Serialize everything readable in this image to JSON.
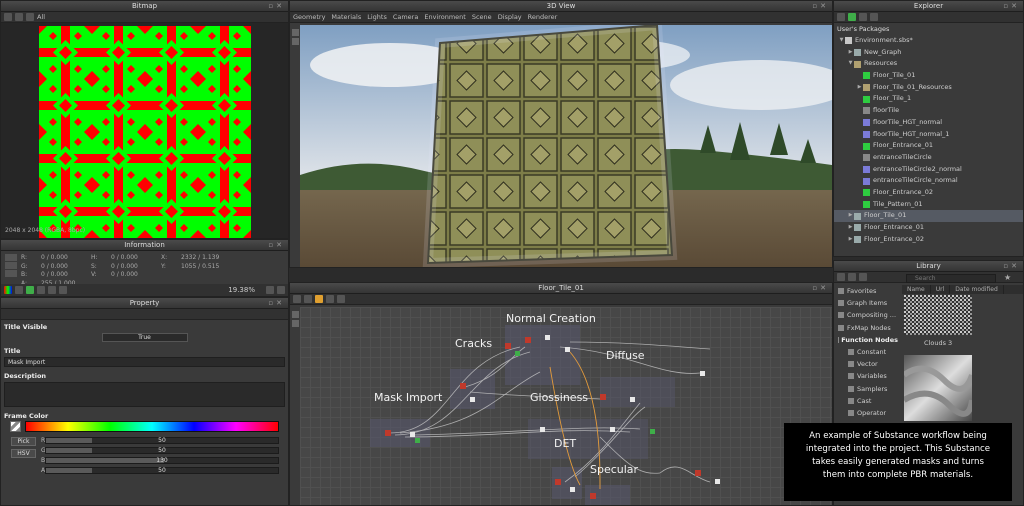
{
  "bitmap": {
    "title": "Bitmap",
    "caption": "2048 x 2048 (RGBA, 8bpc)",
    "mode_label": "All"
  },
  "information": {
    "title": "Information",
    "rows": [
      [
        "R:",
        "0 / 0.000",
        "H:",
        "0 / 0.000",
        "X:",
        "2332 / 1.139"
      ],
      [
        "G:",
        "0 / 0.000",
        "S:",
        "0 / 0.000",
        "Y:",
        "1055 / 0.515"
      ],
      [
        "B:",
        "0 / 0.000",
        "V:",
        "0 / 0.000",
        "",
        ""
      ],
      [
        "A:",
        "255 / 1.000",
        "",
        "",
        "",
        ""
      ]
    ],
    "zoom": "19.38%"
  },
  "property": {
    "title": "Property",
    "sections": {
      "title_visible": "Title Visible",
      "title_visible_value": "True",
      "title": "Title",
      "title_value": "Mask Import",
      "description": "Description",
      "frame_color": "Frame Color"
    },
    "pick": "Pick",
    "hsv": "HSV",
    "channels": [
      {
        "label": "R",
        "value": "50",
        "fraction": 0.2
      },
      {
        "label": "G",
        "value": "50",
        "fraction": 0.2
      },
      {
        "label": "B",
        "value": "130",
        "fraction": 0.51
      },
      {
        "label": "A",
        "value": "50",
        "fraction": 0.2
      }
    ]
  },
  "view3d": {
    "title": "3D View",
    "menu": [
      "Geometry",
      "Materials",
      "Lights",
      "Camera",
      "Environment",
      "Scene",
      "Display",
      "Renderer"
    ]
  },
  "graph": {
    "title": "Floor_Tile_01",
    "frames": [
      "Normal Creation",
      "Cracks",
      "Diffuse",
      "Mask Import",
      "Glossiness",
      "DET",
      "Specular"
    ]
  },
  "explorer": {
    "title": "Explorer",
    "root": "User's Packages",
    "items": [
      {
        "label": "Environment.sbs*",
        "level": 0,
        "icon": "package",
        "twisty": "down"
      },
      {
        "label": "New_Graph",
        "level": 1,
        "icon": "graph",
        "twisty": "right"
      },
      {
        "label": "Resources",
        "level": 1,
        "icon": "folder",
        "twisty": "down"
      },
      {
        "label": "Floor_Tile_01",
        "level": 2,
        "icon": "bitmap-green",
        "twisty": ""
      },
      {
        "label": "Floor_Tile_01_Resources",
        "level": 2,
        "icon": "folder",
        "twisty": "right"
      },
      {
        "label": "Floor_Tile_1",
        "level": 2,
        "icon": "bitmap-green",
        "twisty": ""
      },
      {
        "label": "floorTile",
        "level": 2,
        "icon": "bitmap-gray",
        "twisty": ""
      },
      {
        "label": "floorTile_HGT_normal",
        "level": 2,
        "icon": "bitmap-blue",
        "twisty": ""
      },
      {
        "label": "floorTile_HGT_normal_1",
        "level": 2,
        "icon": "bitmap-blue",
        "twisty": ""
      },
      {
        "label": "Floor_Entrance_01",
        "level": 2,
        "icon": "bitmap-green",
        "twisty": ""
      },
      {
        "label": "entranceTileCircle",
        "level": 2,
        "icon": "bitmap-gray",
        "twisty": ""
      },
      {
        "label": "entranceTileCircle2_normal",
        "level": 2,
        "icon": "bitmap-blue",
        "twisty": ""
      },
      {
        "label": "entranceTileCircle_normal",
        "level": 2,
        "icon": "bitmap-blue",
        "twisty": ""
      },
      {
        "label": "Floor_Entrance_02",
        "level": 2,
        "icon": "bitmap-green",
        "twisty": ""
      },
      {
        "label": "Tile_Pattern_01",
        "level": 2,
        "icon": "bitmap-green",
        "twisty": ""
      },
      {
        "label": "Floor_Tile_01",
        "level": 1,
        "icon": "graph",
        "twisty": "right",
        "selected": true
      },
      {
        "label": "Floor_Entrance_01",
        "level": 1,
        "icon": "graph",
        "twisty": "right"
      },
      {
        "label": "Floor_Entrance_02",
        "level": 1,
        "icon": "graph",
        "twisty": "right"
      }
    ]
  },
  "library": {
    "title": "Library",
    "search_placeholder": "Search",
    "columns": [
      "Name",
      "Url",
      "Date modified"
    ],
    "categories": [
      {
        "label": "Favorites",
        "bold": false,
        "sub": false
      },
      {
        "label": "Graph Items",
        "bold": false,
        "sub": false
      },
      {
        "label": "Compositing ...",
        "bold": false,
        "sub": false
      },
      {
        "label": "FxMap Nodes",
        "bold": false,
        "sub": false
      },
      {
        "label": "Function Nodes",
        "bold": true,
        "sub": false
      },
      {
        "label": "Constant",
        "bold": false,
        "sub": true
      },
      {
        "label": "Vector",
        "bold": false,
        "sub": true
      },
      {
        "label": "Variables",
        "bold": false,
        "sub": true
      },
      {
        "label": "Samplers",
        "bold": false,
        "sub": true
      },
      {
        "label": "Cast",
        "bold": false,
        "sub": true
      },
      {
        "label": "Operator",
        "bold": false,
        "sub": true
      }
    ],
    "thumbs": [
      "Clouds 3"
    ]
  },
  "caption": {
    "lines": [
      "An example of Substance workflow being",
      "integrated into the project.  This Substance",
      "takes easily generated masks and turns",
      "them into complete PBR materials."
    ]
  },
  "colors": {
    "mask_green": "#00ff00",
    "mask_red": "#ff0000",
    "selection": "#555a63",
    "accent_green": "#3fae49"
  }
}
